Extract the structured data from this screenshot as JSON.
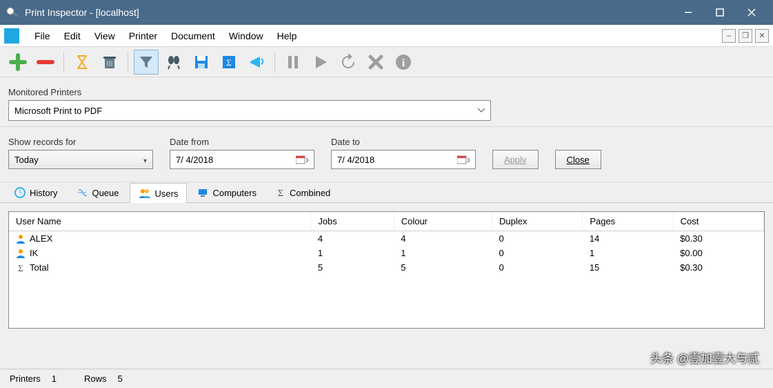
{
  "title": "Print Inspector - [localhost]",
  "menu": [
    "File",
    "Edit",
    "View",
    "Printer",
    "Document",
    "Window",
    "Help"
  ],
  "monitored": {
    "legend": "Monitored Printers",
    "value": "Microsoft Print to PDF"
  },
  "filter": {
    "show_label": "Show records for",
    "show_value": "Today",
    "from_label": "Date from",
    "from_value": "7/ 4/2018",
    "to_label": "Date to",
    "to_value": "7/ 4/2018",
    "apply": "Apply",
    "close": "Close"
  },
  "tabs": {
    "history": "History",
    "queue": "Queue",
    "users": "Users",
    "computers": "Computers",
    "combined": "Combined"
  },
  "grid": {
    "headers": [
      "User Name",
      "Jobs",
      "Colour",
      "Duplex",
      "Pages",
      "Cost"
    ],
    "rows": [
      {
        "name": "ALEX",
        "jobs": "4",
        "colour": "4",
        "duplex": "0",
        "pages": "14",
        "cost": "$0.30"
      },
      {
        "name": "IK",
        "jobs": "1",
        "colour": "1",
        "duplex": "0",
        "pages": "1",
        "cost": "$0.00"
      },
      {
        "name": "Total",
        "jobs": "5",
        "colour": "5",
        "duplex": "0",
        "pages": "15",
        "cost": "$0.30"
      }
    ]
  },
  "status": {
    "printers_label": "Printers",
    "printers": "1",
    "rows_label": "Rows",
    "rows": "5"
  },
  "watermark": "头条 @壹加壹大与贰"
}
